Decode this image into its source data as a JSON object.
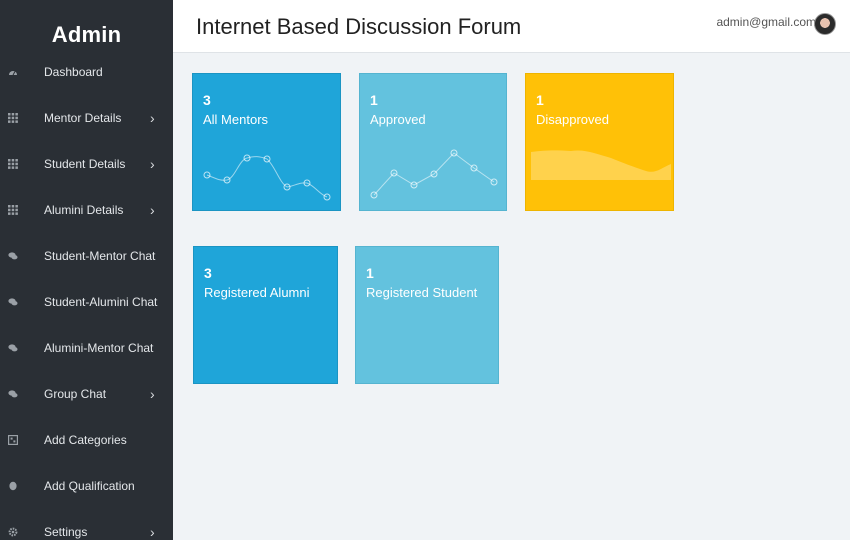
{
  "sidebar": {
    "brand": "Admin",
    "items": [
      {
        "label": "Dashboard",
        "icon": "dashboard-icon",
        "has_submenu": false
      },
      {
        "label": "Mentor Details",
        "icon": "grid-icon",
        "has_submenu": true
      },
      {
        "label": "Student Details",
        "icon": "grid-icon",
        "has_submenu": true
      },
      {
        "label": "Alumini Details",
        "icon": "grid-icon",
        "has_submenu": true
      },
      {
        "label": "Student-Mentor Chat",
        "icon": "chat-icon",
        "has_submenu": false
      },
      {
        "label": "Student-Alumini Chat",
        "icon": "chat-icon",
        "has_submenu": false
      },
      {
        "label": "Alumini-Mentor Chat",
        "icon": "chat-icon",
        "has_submenu": false
      },
      {
        "label": "Group Chat",
        "icon": "chat-icon",
        "has_submenu": true
      },
      {
        "label": "Add Categories",
        "icon": "categories-icon",
        "has_submenu": false
      },
      {
        "label": "Add Qualification",
        "icon": "qualification-icon",
        "has_submenu": false
      },
      {
        "label": "Settings",
        "icon": "gear-icon",
        "has_submenu": true
      }
    ],
    "chevron": "›"
  },
  "header": {
    "title": "Internet Based Discussion Forum",
    "user_email": "admin@gmail.com"
  },
  "cards": [
    {
      "count": "3",
      "label": "All Mentors",
      "color": "#1fa5d9",
      "decoration": "line-chart"
    },
    {
      "count": "1",
      "label": "Approved",
      "color": "#63c2de",
      "decoration": "line-chart"
    },
    {
      "count": "1",
      "label": "Disapproved",
      "color": "#ffc107",
      "decoration": "area-chart"
    },
    {
      "count": "3",
      "label": "Registered Alumni",
      "color": "#1fa5d9",
      "decoration": "none"
    },
    {
      "count": "1",
      "label": "Registered Student",
      "color": "#63c2de",
      "decoration": "none"
    }
  ],
  "colors": {
    "sidebar_bg": "#2a2f35",
    "page_bg": "#f0f3f6",
    "primary": "#1fa5d9",
    "info": "#63c2de",
    "warning": "#ffc107"
  }
}
